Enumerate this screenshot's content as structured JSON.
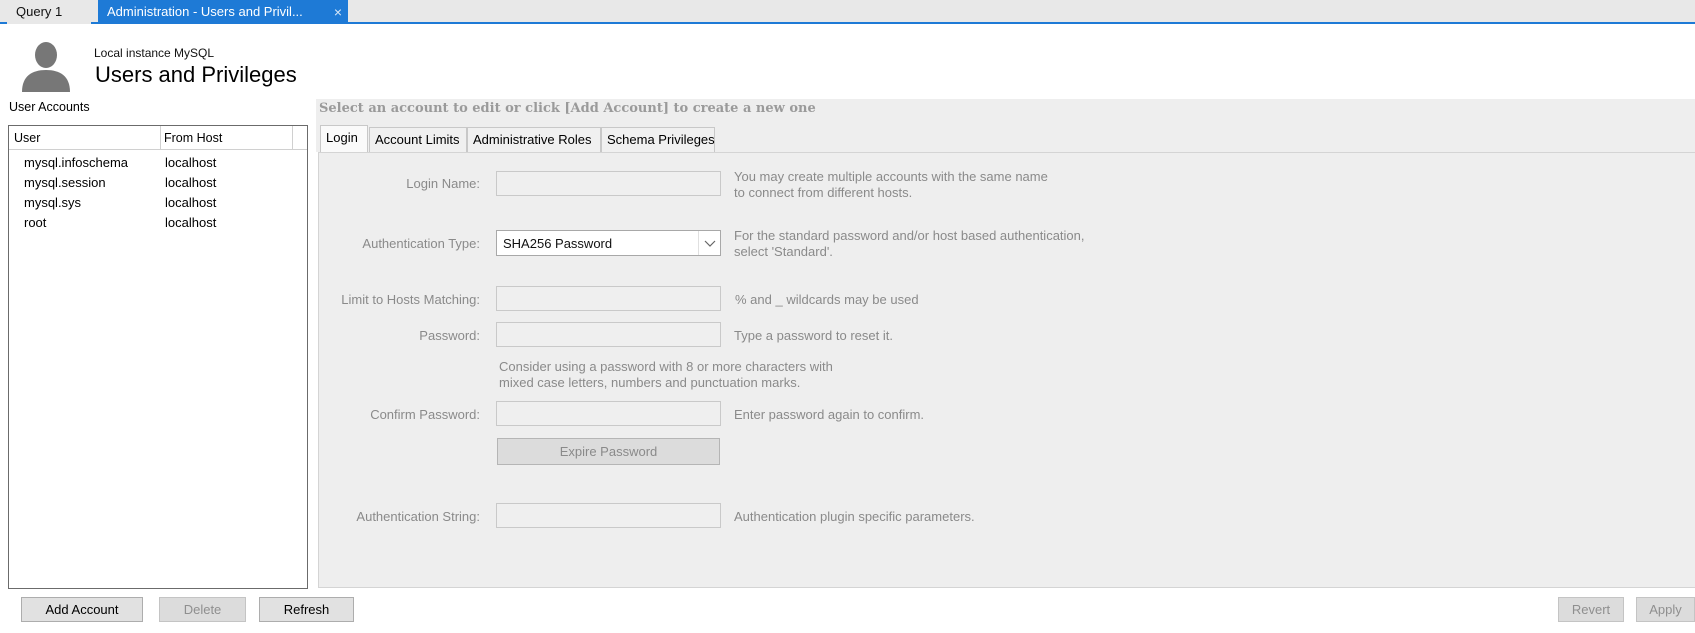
{
  "doc_tabs": [
    {
      "label": "Query 1"
    },
    {
      "label": "Administration - Users and Privil...",
      "close": "×"
    }
  ],
  "header": {
    "instance": "Local instance MySQL",
    "title": "Users and Privileges",
    "icon": "user-avatar-icon"
  },
  "user_accounts": {
    "label": "User Accounts",
    "columns": [
      "User",
      "From Host"
    ],
    "rows": [
      {
        "user": "mysql.infoschema",
        "host": "localhost"
      },
      {
        "user": "mysql.session",
        "host": "localhost"
      },
      {
        "user": "mysql.sys",
        "host": "localhost"
      },
      {
        "user": "root",
        "host": "localhost"
      }
    ]
  },
  "details": {
    "hint": "Select an account to edit or click [Add Account] to create a new one",
    "tabs": [
      "Login",
      "Account Limits",
      "Administrative Roles",
      "Schema Privileges"
    ],
    "active_tab": "Login",
    "login": {
      "login_name_label": "Login Name:",
      "login_name_value": "",
      "login_name_help_1": "You may create multiple accounts with the same name",
      "login_name_help_2": "to connect from different hosts.",
      "auth_type_label": "Authentication Type:",
      "auth_type_value": "SHA256 Password",
      "auth_type_help_1": "For the standard password and/or host based authentication,",
      "auth_type_help_2": "select 'Standard'.",
      "hosts_label": "Limit to Hosts Matching:",
      "hosts_value": "",
      "hosts_help": "% and _ wildcards may be used",
      "password_label": "Password:",
      "password_value": "",
      "password_help": "Type a password to reset it.",
      "password_advice_1": "Consider using a password with 8 or more characters with",
      "password_advice_2": "mixed case letters, numbers and punctuation marks.",
      "confirm_label": "Confirm Password:",
      "confirm_value": "",
      "confirm_help": "Enter password again to confirm.",
      "expire_button": "Expire Password",
      "auth_string_label": "Authentication String:",
      "auth_string_value": "",
      "auth_string_help": "Authentication plugin specific parameters."
    }
  },
  "buttons": {
    "add_account": "Add Account",
    "delete": "Delete",
    "refresh": "Refresh",
    "revert": "Revert",
    "apply": "Apply"
  },
  "colors": {
    "accent": "#1e7ad6",
    "panel_bg": "#eeeeee",
    "disabled_text": "#8a8a8a"
  }
}
